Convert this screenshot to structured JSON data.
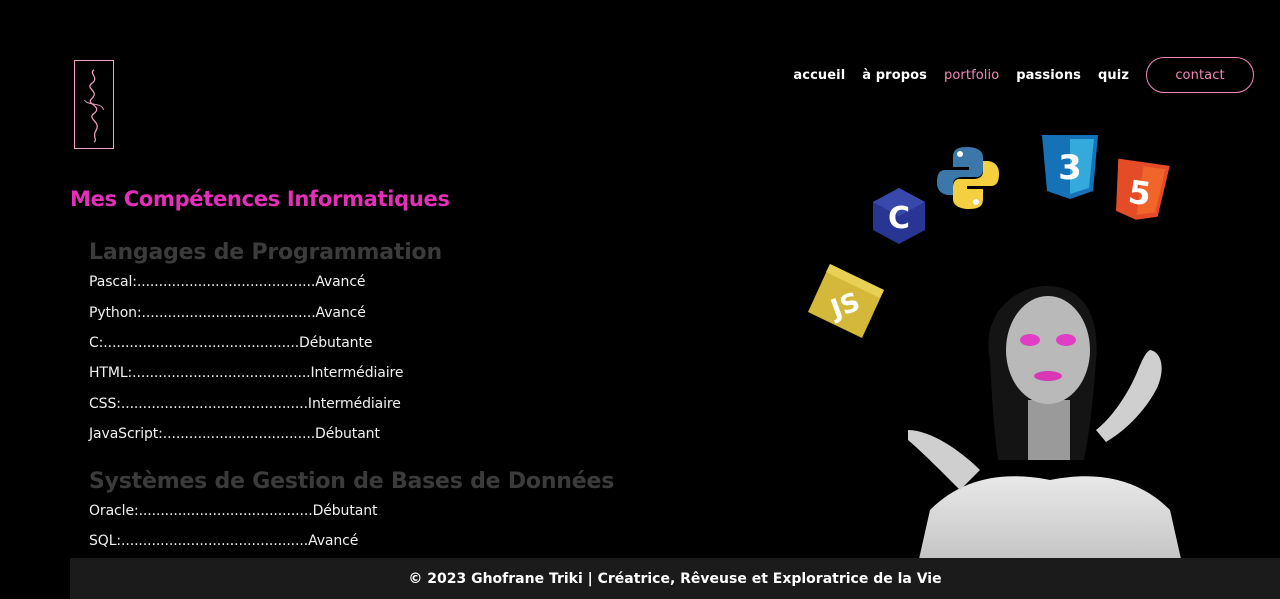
{
  "nav": {
    "items": [
      "accueil",
      "à propos",
      "portfolio",
      "passions",
      "quiz"
    ],
    "active": "portfolio",
    "contact_label": "contact"
  },
  "page_title": "Mes Compétences Informatiques",
  "sections": [
    {
      "title": "Langages de Programmation",
      "skills": [
        "Pascal:.........................................Avancé",
        "Python:........................................Avancé",
        "C:.............................................Débutante",
        "HTML:.........................................Intermédiaire",
        "CSS:...........................................Intermédiaire",
        "JavaScript:...................................Débutant"
      ]
    },
    {
      "title": "Systèmes de Gestion de Bases de Données",
      "skills": [
        "Oracle:........................................Débutant",
        "SQL:...........................................Avancé"
      ]
    }
  ],
  "icons": [
    "c-logo-icon",
    "python-logo-icon",
    "css3-logo-icon",
    "html5-logo-icon",
    "javascript-logo-icon"
  ],
  "footer_text": "© 2023 Ghofrane Triki | Créatrice, Rêveuse et Exploratrice de la Vie",
  "colors": {
    "accent": "#e62fb8",
    "nav_active": "#f08abd",
    "background": "#000000"
  }
}
